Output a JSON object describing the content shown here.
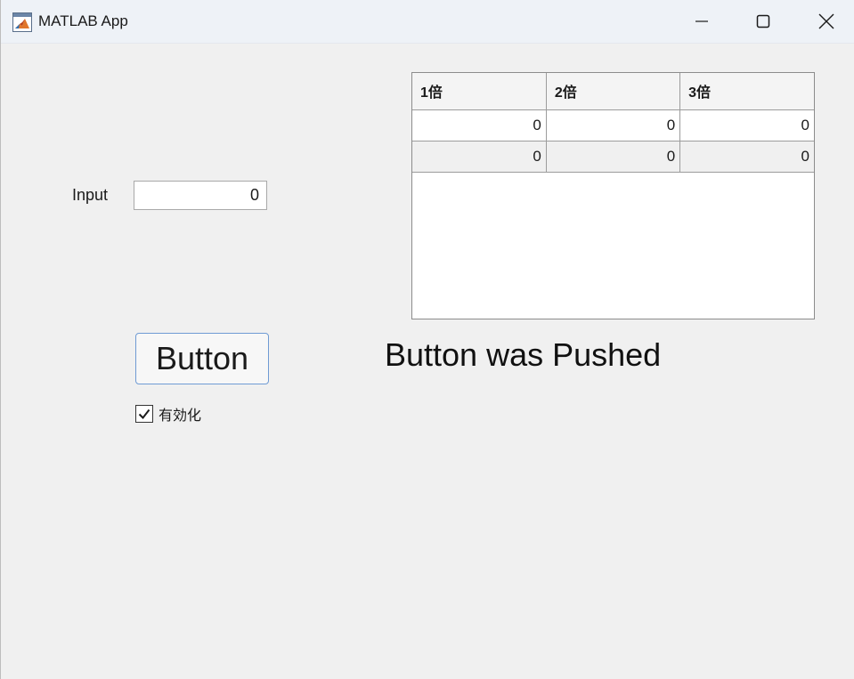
{
  "window": {
    "title": "MATLAB App",
    "icon": "matlab-icon",
    "controls": [
      "minimize-icon",
      "maximize-icon",
      "close-icon"
    ]
  },
  "input": {
    "label": "Input",
    "value": "0"
  },
  "table": {
    "columns": [
      "1倍",
      "2倍",
      "3倍"
    ],
    "rows": [
      [
        "0",
        "0",
        "0"
      ],
      [
        "0",
        "0",
        "0"
      ]
    ]
  },
  "button": {
    "label": "Button"
  },
  "status": {
    "text": "Button was Pushed"
  },
  "checkbox": {
    "label": "有効化",
    "checked": true
  },
  "colors": {
    "background": "#f0f0f0",
    "titlebar": "#eef2f7",
    "button_border": "#6f9bd4",
    "table_border": "#8c8c8c"
  }
}
